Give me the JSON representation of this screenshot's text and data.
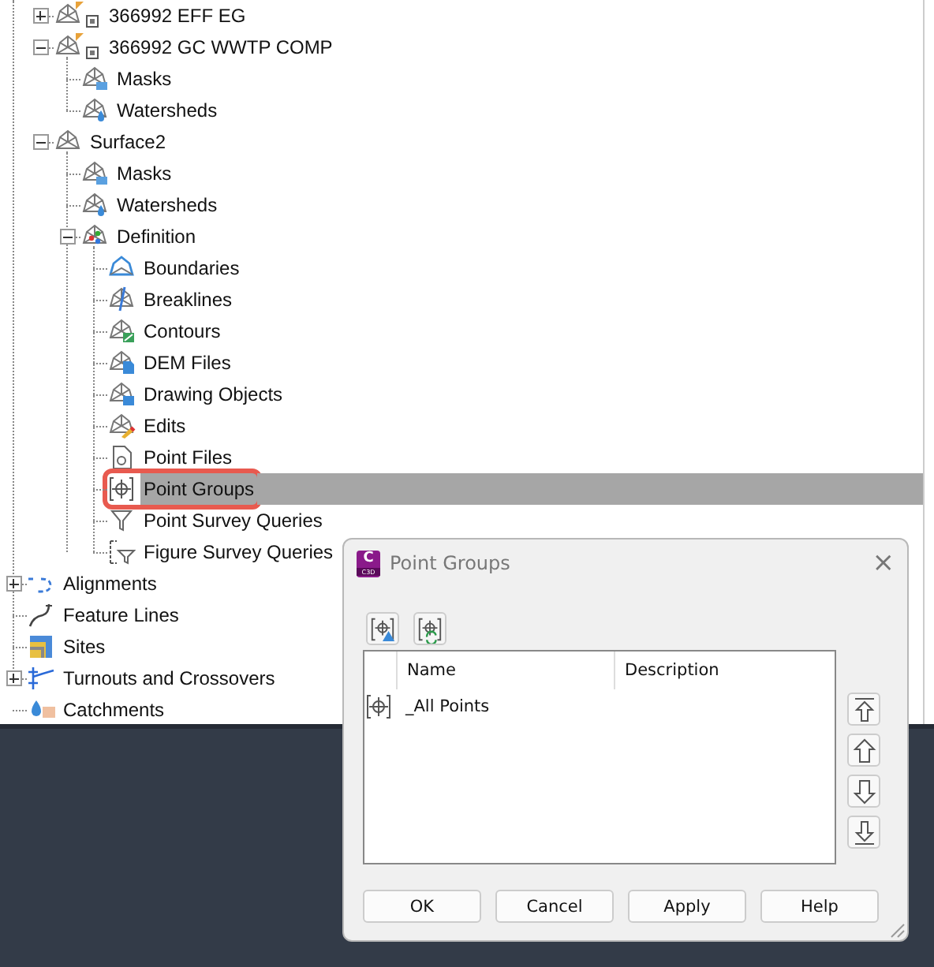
{
  "tree": {
    "continued_children": [
      {
        "label": "366992 EFF EG",
        "kind": "surface-ref",
        "expanded": false,
        "selected": false,
        "callout": false
      },
      {
        "label": "366992 GC WWTP COMP",
        "kind": "surface-ref",
        "expanded": true,
        "selected": false,
        "callout": false,
        "children": [
          {
            "label": "Masks",
            "kind": "masks",
            "selected": false,
            "callout": false
          },
          {
            "label": "Watersheds",
            "kind": "watersheds",
            "selected": false,
            "callout": false
          }
        ]
      },
      {
        "label": "Surface2",
        "kind": "surface",
        "expanded": true,
        "selected": false,
        "callout": false,
        "children": [
          {
            "label": "Masks",
            "kind": "masks",
            "selected": false,
            "callout": false
          },
          {
            "label": "Watersheds",
            "kind": "watersheds",
            "selected": false,
            "callout": false
          },
          {
            "label": "Definition",
            "kind": "definition",
            "expanded": true,
            "selected": false,
            "callout": false,
            "children": [
              {
                "label": "Boundaries",
                "kind": "boundaries",
                "selected": false,
                "callout": false
              },
              {
                "label": "Breaklines",
                "kind": "breaklines",
                "selected": false,
                "callout": false
              },
              {
                "label": "Contours",
                "kind": "contours",
                "selected": false,
                "callout": false
              },
              {
                "label": "DEM Files",
                "kind": "dem",
                "selected": false,
                "callout": false
              },
              {
                "label": "Drawing Objects",
                "kind": "drawing-objects",
                "selected": false,
                "callout": false
              },
              {
                "label": "Edits",
                "kind": "edits",
                "selected": false,
                "callout": false
              },
              {
                "label": "Point Files",
                "kind": "point-files",
                "selected": false,
                "callout": false
              },
              {
                "label": "Point Groups",
                "kind": "point-groups",
                "selected": true,
                "callout": true
              },
              {
                "label": "Point Survey Queries",
                "kind": "survey-queries",
                "selected": false,
                "callout": false
              },
              {
                "label": "Figure Survey Queries",
                "kind": "figure-queries",
                "selected": false,
                "callout": false
              }
            ]
          }
        ]
      }
    ],
    "items": [
      {
        "label": "Alignments",
        "kind": "alignments",
        "expanded": false,
        "selected": false,
        "callout": false
      },
      {
        "label": "Feature Lines",
        "kind": "feature-lines",
        "selected": false,
        "callout": false
      },
      {
        "label": "Sites",
        "kind": "sites",
        "selected": false,
        "callout": false
      },
      {
        "label": "Turnouts and Crossovers",
        "kind": "turnouts",
        "expanded": false,
        "selected": false,
        "callout": false
      },
      {
        "label": "Catchments",
        "kind": "catchments",
        "selected": false,
        "callout": false
      }
    ]
  },
  "dialog": {
    "app_badge": "C",
    "app_badge_sub": "C3D",
    "title": "Point Groups",
    "close": "×",
    "toolbar": [
      {
        "kind": "new"
      },
      {
        "kind": "update"
      }
    ],
    "table": {
      "columns": [
        "Name",
        "Description"
      ],
      "rows": [
        {
          "name": "_All Points",
          "description": ""
        }
      ]
    },
    "order_buttons": [
      {
        "kind": "top"
      },
      {
        "kind": "up"
      },
      {
        "kind": "down"
      },
      {
        "kind": "bottom"
      }
    ],
    "buttons": [
      "OK",
      "Cancel",
      "Apply",
      "Help"
    ]
  }
}
